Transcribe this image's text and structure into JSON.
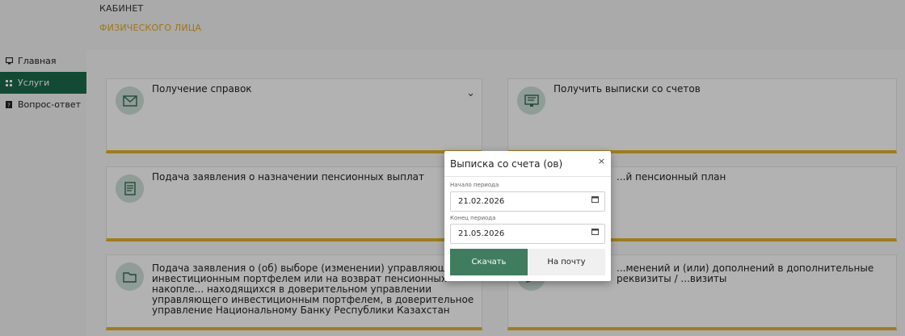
{
  "header": {
    "brand_line1": "КАБИНЕТ",
    "brand_line2": "ФИЗИЧЕСКОГО ЛИЦА"
  },
  "sidebar": {
    "items": [
      {
        "label": "Главная",
        "icon": "monitor-icon",
        "active": false
      },
      {
        "label": "Услуги",
        "icon": "grid-icon",
        "active": true
      },
      {
        "label": "Вопрос-ответ",
        "icon": "question-icon",
        "active": false
      }
    ]
  },
  "cards": [
    {
      "title": "Получение справок",
      "icon": "envelope-icon",
      "expandable": true
    },
    {
      "title": "Получить выписки со счетов",
      "icon": "monitor-doc-icon"
    },
    {
      "title": "Подача заявления о назначении пенсионных выплат",
      "icon": "document-icon"
    },
    {
      "title": "...й пенсионный план",
      "icon": "plan-icon"
    },
    {
      "title": "Подача заявления о (об) выборе (изменении) управляющего инвестиционным портфелем или на возврат пенсионных накопле... находящихся в доверительном управлении управляющего инвестиционным портфелем, в доверительное управление Национальному Банку Республики Казахстан",
      "icon": "folder-icon"
    },
    {
      "title": "...менений и (или) дополнений в дополнительные реквизиты / ...визиты",
      "icon": "edit-icon"
    }
  ],
  "modal": {
    "title": "Выписка со счета (ов)",
    "close_label": "×",
    "start_label": "Начало периода",
    "start_value": "21.02.2026",
    "end_label": "Конец периода",
    "end_value": "21.05.2026",
    "download_label": "Скачать",
    "email_label": "На почту"
  },
  "colors": {
    "accent": "#1b6b4a",
    "brand_orange": "#e6a817",
    "card_border": "#e6b422",
    "button": "#3f7d5e"
  }
}
